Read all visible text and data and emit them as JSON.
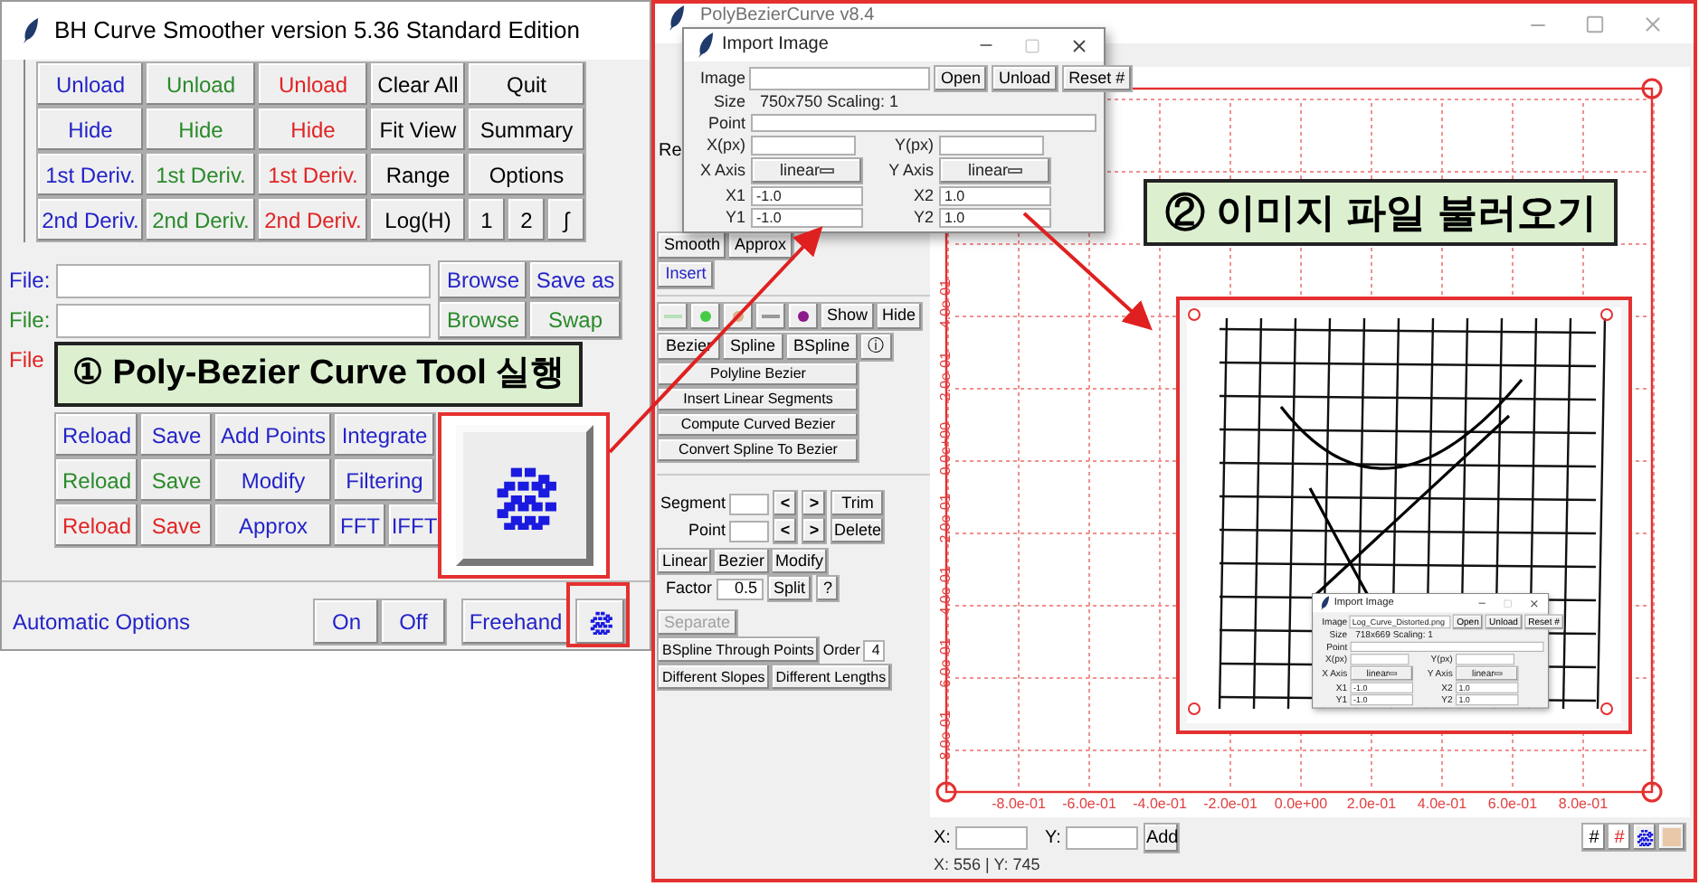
{
  "smoother": {
    "title": "BH Curve Smoother version 5.36 Standard Edition",
    "grid": [
      [
        {
          "label": "Unload",
          "color": "#2323c8"
        },
        {
          "label": "Unload",
          "color": "#2a8a2a"
        },
        {
          "label": "Unload",
          "color": "#e02424"
        },
        {
          "label": "Clear All",
          "color": "#000000"
        },
        {
          "label": "Quit",
          "color": "#000000"
        }
      ],
      [
        {
          "label": "Hide",
          "color": "#2323c8"
        },
        {
          "label": "Hide",
          "color": "#2a8a2a"
        },
        {
          "label": "Hide",
          "color": "#e02424"
        },
        {
          "label": "Fit View",
          "color": "#000000"
        },
        {
          "label": "Summary",
          "color": "#000000"
        }
      ],
      [
        {
          "label": "1st Deriv.",
          "color": "#2323c8"
        },
        {
          "label": "1st Deriv.",
          "color": "#2a8a2a"
        },
        {
          "label": "1st Deriv.",
          "color": "#e02424"
        },
        {
          "label": "Range",
          "color": "#000000"
        },
        {
          "label": "Options",
          "color": "#000000"
        }
      ],
      [
        {
          "label": "2nd Deriv.",
          "color": "#2323c8"
        },
        {
          "label": "2nd Deriv.",
          "color": "#2a8a2a"
        },
        {
          "label": "2nd Deriv.",
          "color": "#e02424"
        },
        {
          "label": "Log(H)",
          "color": "#000000"
        },
        {
          "label": "1",
          "color": "#000000"
        },
        {
          "label": "2",
          "color": "#000000"
        },
        {
          "label": "∫",
          "color": "#000000"
        }
      ]
    ],
    "files": [
      {
        "label": "File:",
        "color": "#2323c8",
        "buttons": [
          "Browse",
          "Save as"
        ]
      },
      {
        "label": "File:",
        "color": "#2a8a2a",
        "buttons": [
          "Browse",
          "Swap"
        ]
      },
      {
        "label": "File",
        "color": "#e02424"
      }
    ],
    "actions": [
      [
        {
          "label": "Reload",
          "color": "#2323c8"
        },
        {
          "label": "Save",
          "color": "#2323c8"
        },
        {
          "label": "Add Points",
          "color": "#2323c8"
        },
        {
          "label": "Integrate",
          "color": "#2323c8"
        }
      ],
      [
        {
          "label": "Reload",
          "color": "#2a8a2a"
        },
        {
          "label": "Save",
          "color": "#2a8a2a"
        },
        {
          "label": "Modify",
          "color": "#2323c8"
        },
        {
          "label": "Filtering",
          "color": "#2323c8"
        }
      ],
      [
        {
          "label": "Reload",
          "color": "#e02424"
        },
        {
          "label": "Save",
          "color": "#e02424"
        },
        {
          "label": "Approx",
          "color": "#2323c8"
        },
        {
          "label": "FFT",
          "color": "#2323c8"
        },
        {
          "label": "IFFT",
          "color": "#2323c8"
        }
      ]
    ],
    "auto": {
      "label": "Automatic Options",
      "buttons": [
        "On",
        "Off"
      ],
      "freehand": "Freehand"
    }
  },
  "pbc": {
    "title": "PolyBezierCurve v8.4",
    "partial_label": "Re",
    "smooth_buttons": [
      "Smooth",
      "Approx"
    ],
    "insert": "Insert",
    "swatches": [
      {
        "kind": "line",
        "color": "#b8e0b8"
      },
      {
        "kind": "dot",
        "color": "#44cc44"
      },
      {
        "kind": "dot",
        "color": "#d9b38c"
      },
      {
        "kind": "line",
        "color": "#999999"
      },
      {
        "kind": "dot",
        "color": "#8b1a8b"
      }
    ],
    "show_hide": [
      "Show",
      "Hide"
    ],
    "curve_types": [
      "Bezier",
      "Spline",
      "BSpline",
      "ⓘ"
    ],
    "commands": [
      "Polyline Bezier",
      "Insert Linear Segments",
      "Compute Curved Bezier",
      "Convert Spline To Bezier"
    ],
    "steppers": [
      {
        "label": "Segment",
        "prev": "<",
        "next": ">",
        "button": "Trim"
      },
      {
        "label": "Point",
        "prev": "<",
        "next": ">",
        "button": "Delete"
      }
    ],
    "modes": [
      "Linear",
      "Bezier",
      "Modify"
    ],
    "factor": {
      "label": "Factor",
      "value": "0.5",
      "buttons": [
        "Split",
        "?"
      ]
    },
    "separate": {
      "label": "Separate",
      "disabled": true
    },
    "bspline": {
      "button": "BSpline Through Points",
      "order_label": "Order",
      "order": "4"
    },
    "different": [
      "Different Slopes",
      "Different Lengths"
    ],
    "x_ticks": [
      "-8.0e-01",
      "-6.0e-01",
      "-4.0e-01",
      "-2.0e-01",
      "0.0e+00",
      "2.0e-01",
      "4.0e-01",
      "6.0e-01",
      "8.0e-01"
    ],
    "y_ticks": [
      "4.0e-01",
      "2.0e-01",
      "0.0e+00",
      "-2.0e-01",
      "-4.0e-01",
      "-6.0e-01",
      "-8.0e-01"
    ],
    "x_label": "X:",
    "y_label": "Y:",
    "add": "Add",
    "status": "X: 556 | Y: 745",
    "toggles": [
      {
        "label": "#",
        "color": "#000000"
      },
      {
        "label": "#",
        "color": "#e02424"
      }
    ],
    "swatch": {
      "color": "#e8c8a8"
    }
  },
  "dialogs": [
    {
      "kind": "large",
      "title": "Import Image",
      "image_label": "Image",
      "buttons": [
        "Open",
        "Unload",
        "Reset #"
      ],
      "size_label": "Size",
      "size": "750x750  Scaling: 1",
      "point_label": "Point",
      "xpx": "X(px)",
      "ypx": "Y(px)",
      "xaxis": "X Axis",
      "xaxis_value": "linear",
      "yaxis": "Y Axis",
      "yaxis_value": "linear",
      "x1": "X1",
      "x1_value": "-1.0",
      "y1": "Y1",
      "y1_value": "-1.0",
      "x2": "X2",
      "x2_value": "1.0",
      "y2": "Y2",
      "y2_value": "1.0"
    },
    {
      "kind": "small",
      "title": "Import Image",
      "image_label": "Image",
      "image_value": "Log_Curve_Distorted.png",
      "buttons": [
        "Open",
        "Unload",
        "Reset #"
      ],
      "size_label": "Size",
      "size": "718x669  Scaling: 1",
      "point_label": "Point",
      "xpx": "X(px)",
      "ypx": "Y(px)",
      "xaxis": "X Axis",
      "xaxis_value": "linear",
      "yaxis": "Y Axis",
      "yaxis_value": "linear",
      "x1": "X1",
      "x1_value": "-1.0",
      "y1": "Y1",
      "y1_value": "-1.0",
      "x2": "X2",
      "x2_value": "1.0",
      "y2": "Y2",
      "y2_value": "1.0"
    }
  ],
  "callouts": [
    {
      "text": "① Poly-Bezier Curve Tool 실행"
    },
    {
      "text": "② 이미지 파일 불러오기"
    }
  ]
}
